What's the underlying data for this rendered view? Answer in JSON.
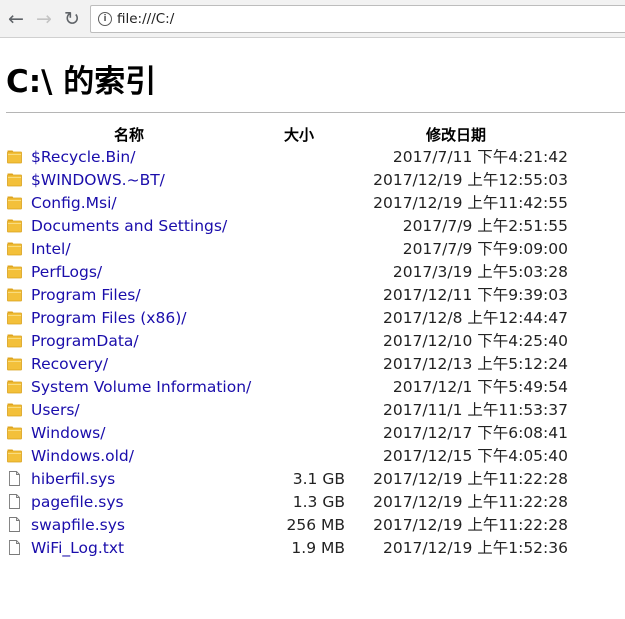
{
  "browser": {
    "back_icon": "arrow-left-icon",
    "forward_icon": "arrow-right-icon",
    "reload_icon": "reload-icon",
    "info_icon": "info-icon",
    "url": "file:///C:/"
  },
  "page": {
    "title": "C:\\ 的索引",
    "headers": {
      "name": "名称",
      "size": "大小",
      "modified": "修改日期"
    },
    "link_color": "#1a0dab",
    "folder_color": "#f3c03a"
  },
  "entries": [
    {
      "type": "folder",
      "name": "$Recycle.Bin/",
      "size": "",
      "modified": "2017/7/11 下午4:21:42"
    },
    {
      "type": "folder",
      "name": "$WINDOWS.~BT/",
      "size": "",
      "modified": "2017/12/19 上午12:55:03"
    },
    {
      "type": "folder",
      "name": "Config.Msi/",
      "size": "",
      "modified": "2017/12/19 上午11:42:55"
    },
    {
      "type": "folder",
      "name": "Documents and Settings/",
      "size": "",
      "modified": "2017/7/9 上午2:51:55"
    },
    {
      "type": "folder",
      "name": "Intel/",
      "size": "",
      "modified": "2017/7/9 下午9:09:00"
    },
    {
      "type": "folder",
      "name": "PerfLogs/",
      "size": "",
      "modified": "2017/3/19 上午5:03:28"
    },
    {
      "type": "folder",
      "name": "Program Files/",
      "size": "",
      "modified": "2017/12/11 下午9:39:03"
    },
    {
      "type": "folder",
      "name": "Program Files (x86)/",
      "size": "",
      "modified": "2017/12/8 上午12:44:47"
    },
    {
      "type": "folder",
      "name": "ProgramData/",
      "size": "",
      "modified": "2017/12/10 下午4:25:40"
    },
    {
      "type": "folder",
      "name": "Recovery/",
      "size": "",
      "modified": "2017/12/13 上午5:12:24"
    },
    {
      "type": "folder",
      "name": "System Volume Information/",
      "size": "",
      "modified": "2017/12/1 下午5:49:54"
    },
    {
      "type": "folder",
      "name": "Users/",
      "size": "",
      "modified": "2017/11/1 上午11:53:37"
    },
    {
      "type": "folder",
      "name": "Windows/",
      "size": "",
      "modified": "2017/12/17 下午6:08:41"
    },
    {
      "type": "folder",
      "name": "Windows.old/",
      "size": "",
      "modified": "2017/12/15 下午4:05:40"
    },
    {
      "type": "file",
      "name": "hiberfil.sys",
      "size": "3.1 GB",
      "modified": "2017/12/19 上午11:22:28"
    },
    {
      "type": "file",
      "name": "pagefile.sys",
      "size": "1.3 GB",
      "modified": "2017/12/19 上午11:22:28"
    },
    {
      "type": "file",
      "name": "swapfile.sys",
      "size": "256 MB",
      "modified": "2017/12/19 上午11:22:28"
    },
    {
      "type": "file",
      "name": "WiFi_Log.txt",
      "size": "1.9 MB",
      "modified": "2017/12/19 上午1:52:36"
    }
  ]
}
